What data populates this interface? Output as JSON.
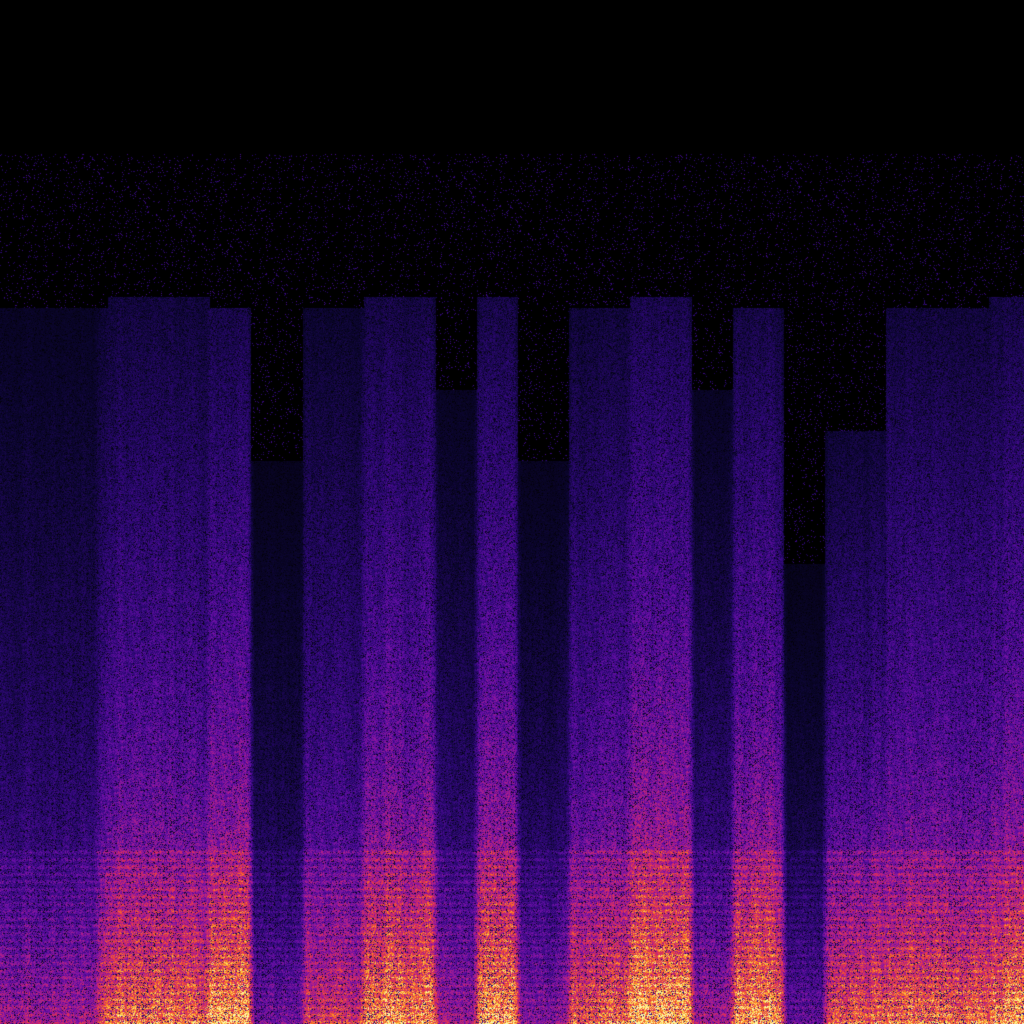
{
  "image": {
    "kind": "spectrogram",
    "colormap": "magma",
    "colormap_stops": [
      "#000000",
      "#0b0530",
      "#30087a",
      "#6a0fa8",
      "#b0208a",
      "#e2304e",
      "#fb7a20",
      "#fcd24a",
      "#fdfcae"
    ],
    "background": "#000000",
    "bright_band_position": "bottom",
    "segments": [
      {
        "start": 0.0,
        "end": 0.095,
        "energy": 0.55,
        "top": 0.7
      },
      {
        "start": 0.095,
        "end": 0.105,
        "energy": 0.75,
        "top": 0.7
      },
      {
        "start": 0.105,
        "end": 0.205,
        "energy": 0.85,
        "top": 0.71
      },
      {
        "start": 0.205,
        "end": 0.245,
        "energy": 1.0,
        "top": 0.7
      },
      {
        "start": 0.245,
        "end": 0.295,
        "energy": 0.45,
        "top": 0.55
      },
      {
        "start": 0.295,
        "end": 0.355,
        "energy": 0.7,
        "top": 0.7
      },
      {
        "start": 0.355,
        "end": 0.425,
        "energy": 0.95,
        "top": 0.71
      },
      {
        "start": 0.425,
        "end": 0.465,
        "energy": 0.55,
        "top": 0.62
      },
      {
        "start": 0.465,
        "end": 0.505,
        "energy": 0.95,
        "top": 0.71
      },
      {
        "start": 0.505,
        "end": 0.555,
        "energy": 0.5,
        "top": 0.55
      },
      {
        "start": 0.555,
        "end": 0.615,
        "energy": 0.8,
        "top": 0.7
      },
      {
        "start": 0.615,
        "end": 0.675,
        "energy": 1.0,
        "top": 0.71
      },
      {
        "start": 0.675,
        "end": 0.715,
        "energy": 0.55,
        "top": 0.62
      },
      {
        "start": 0.715,
        "end": 0.765,
        "energy": 0.95,
        "top": 0.7
      },
      {
        "start": 0.765,
        "end": 0.805,
        "energy": 0.4,
        "top": 0.45
      },
      {
        "start": 0.805,
        "end": 0.865,
        "energy": 0.8,
        "top": 0.58
      },
      {
        "start": 0.865,
        "end": 0.965,
        "energy": 0.85,
        "top": 0.7
      },
      {
        "start": 0.965,
        "end": 1.0,
        "energy": 0.9,
        "top": 0.71
      }
    ]
  }
}
